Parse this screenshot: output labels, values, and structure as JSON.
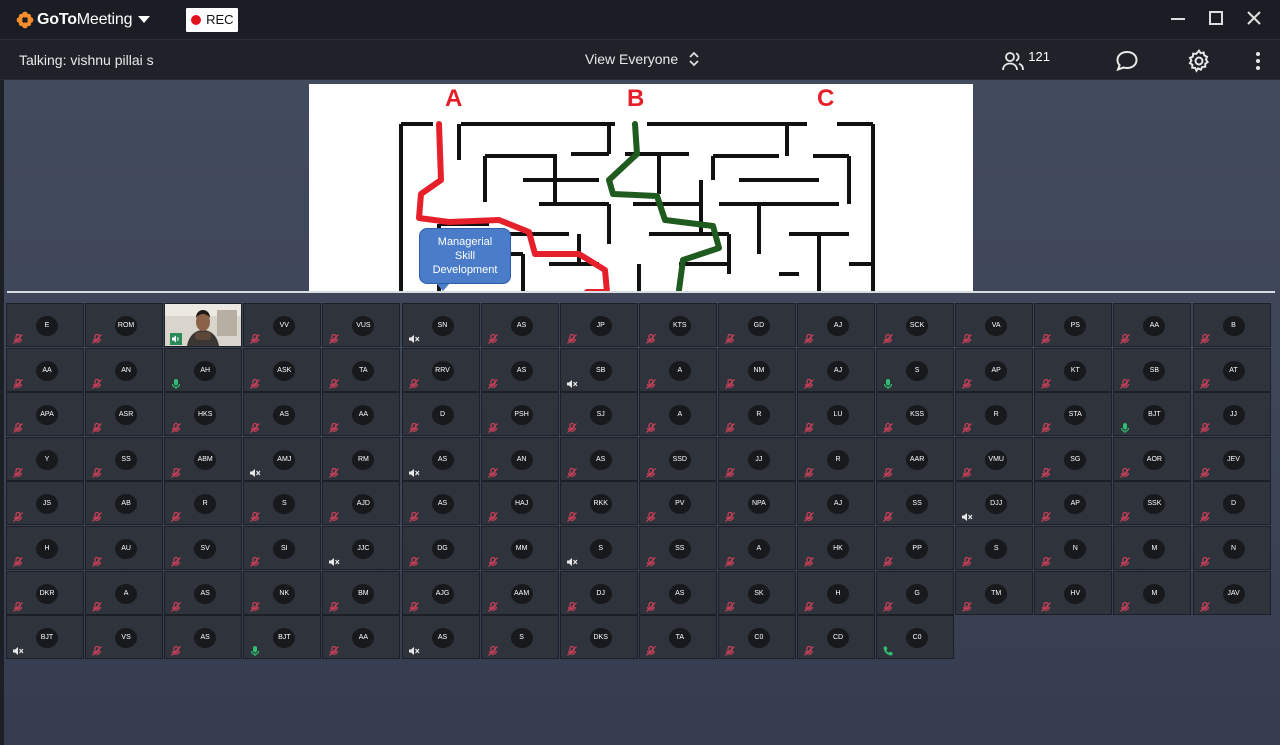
{
  "app": {
    "logo_bold": "GoTo",
    "logo_light": "Meeting",
    "rec_label": "REC"
  },
  "toolbar": {
    "talking": "Talking: vishnu pillai s",
    "view_label": "View Everyone",
    "attendee_count": "121"
  },
  "presentation": {
    "label_a": "A",
    "label_b": "B",
    "label_c": "C",
    "bubble_line1": "Managerial",
    "bubble_line2": "Skill",
    "bubble_line3": "Development"
  },
  "colors": {
    "brand_orange": "#f68d2e",
    "rec_red": "#e0141e",
    "muted_red": "#d0415a",
    "active_green": "#2fbf71",
    "maze_red": "#e5202a",
    "maze_green": "#1f5a1f"
  },
  "participants": [
    {
      "i": "E",
      "s": "m"
    },
    {
      "i": "ROM",
      "s": "m"
    },
    {
      "i": "",
      "s": "video"
    },
    {
      "i": "VV",
      "s": "m"
    },
    {
      "i": "VUS",
      "s": "m"
    },
    {
      "i": "SN",
      "s": "x"
    },
    {
      "i": "AS",
      "s": "m"
    },
    {
      "i": "JP",
      "s": "m"
    },
    {
      "i": "KTS",
      "s": "m"
    },
    {
      "i": "GD",
      "s": "m"
    },
    {
      "i": "AJ",
      "s": "m"
    },
    {
      "i": "SCK",
      "s": "m"
    },
    {
      "i": "VA",
      "s": "m"
    },
    {
      "i": "PS",
      "s": "m"
    },
    {
      "i": "AA",
      "s": "m"
    },
    {
      "i": "B",
      "s": "m"
    },
    {
      "i": "AA",
      "s": "m"
    },
    {
      "i": "AN",
      "s": "m"
    },
    {
      "i": "AH",
      "s": "g"
    },
    {
      "i": "ASK",
      "s": "m"
    },
    {
      "i": "TA",
      "s": "m"
    },
    {
      "i": "RRV",
      "s": "m"
    },
    {
      "i": "AS",
      "s": "m"
    },
    {
      "i": "SB",
      "s": "x"
    },
    {
      "i": "A",
      "s": "m"
    },
    {
      "i": "NM",
      "s": "m"
    },
    {
      "i": "AJ",
      "s": "m"
    },
    {
      "i": "S",
      "s": "g"
    },
    {
      "i": "AP",
      "s": "m"
    },
    {
      "i": "KT",
      "s": "m"
    },
    {
      "i": "SB",
      "s": "m"
    },
    {
      "i": "AT",
      "s": "m"
    },
    {
      "i": "APA",
      "s": "m"
    },
    {
      "i": "ASR",
      "s": "m"
    },
    {
      "i": "HKS",
      "s": "m"
    },
    {
      "i": "AS",
      "s": "m"
    },
    {
      "i": "AA",
      "s": "m"
    },
    {
      "i": "D",
      "s": "m"
    },
    {
      "i": "PSH",
      "s": "m"
    },
    {
      "i": "SJ",
      "s": "m"
    },
    {
      "i": "A",
      "s": "m"
    },
    {
      "i": "R",
      "s": "m"
    },
    {
      "i": "LU",
      "s": "m"
    },
    {
      "i": "KSS",
      "s": "m"
    },
    {
      "i": "R",
      "s": "m"
    },
    {
      "i": "STA",
      "s": "m"
    },
    {
      "i": "BJT",
      "s": "g"
    },
    {
      "i": "JJ",
      "s": "m"
    },
    {
      "i": "Y",
      "s": "m"
    },
    {
      "i": "SS",
      "s": "m"
    },
    {
      "i": "ABM",
      "s": "m"
    },
    {
      "i": "AMJ",
      "s": "x"
    },
    {
      "i": "RM",
      "s": "m"
    },
    {
      "i": "AS",
      "s": "x"
    },
    {
      "i": "AN",
      "s": "m"
    },
    {
      "i": "AS",
      "s": "m"
    },
    {
      "i": "SSD",
      "s": "m"
    },
    {
      "i": "JJ",
      "s": "m"
    },
    {
      "i": "R",
      "s": "m"
    },
    {
      "i": "AAR",
      "s": "m"
    },
    {
      "i": "VMU",
      "s": "m"
    },
    {
      "i": "SG",
      "s": "m"
    },
    {
      "i": "AOR",
      "s": "m"
    },
    {
      "i": "JEV",
      "s": "m"
    },
    {
      "i": "JS",
      "s": "m"
    },
    {
      "i": "AB",
      "s": "m"
    },
    {
      "i": "R",
      "s": "m"
    },
    {
      "i": "S",
      "s": "m"
    },
    {
      "i": "AJD",
      "s": "m"
    },
    {
      "i": "AS",
      "s": "m"
    },
    {
      "i": "HAJ",
      "s": "m"
    },
    {
      "i": "RKK",
      "s": "m"
    },
    {
      "i": "PV",
      "s": "m"
    },
    {
      "i": "NPA",
      "s": "m"
    },
    {
      "i": "AJ",
      "s": "m"
    },
    {
      "i": "SS",
      "s": "m"
    },
    {
      "i": "DJJ",
      "s": "x"
    },
    {
      "i": "AP",
      "s": "m"
    },
    {
      "i": "SSK",
      "s": "m"
    },
    {
      "i": "D",
      "s": "m"
    },
    {
      "i": "H",
      "s": "m"
    },
    {
      "i": "AU",
      "s": "m"
    },
    {
      "i": "SV",
      "s": "m"
    },
    {
      "i": "SI",
      "s": "m"
    },
    {
      "i": "JJC",
      "s": "x"
    },
    {
      "i": "DG",
      "s": "m"
    },
    {
      "i": "MM",
      "s": "m"
    },
    {
      "i": "S",
      "s": "x"
    },
    {
      "i": "SS",
      "s": "m"
    },
    {
      "i": "A",
      "s": "m"
    },
    {
      "i": "HK",
      "s": "m"
    },
    {
      "i": "PP",
      "s": "m"
    },
    {
      "i": "S",
      "s": "m"
    },
    {
      "i": "N",
      "s": "m"
    },
    {
      "i": "M",
      "s": "m"
    },
    {
      "i": "N",
      "s": "m"
    },
    {
      "i": "DKR",
      "s": "m"
    },
    {
      "i": "A",
      "s": "m"
    },
    {
      "i": "AS",
      "s": "m"
    },
    {
      "i": "NK",
      "s": "m"
    },
    {
      "i": "BM",
      "s": "m"
    },
    {
      "i": "AJG",
      "s": "m"
    },
    {
      "i": "AAM",
      "s": "m"
    },
    {
      "i": "DJ",
      "s": "m"
    },
    {
      "i": "AS",
      "s": "m"
    },
    {
      "i": "SK",
      "s": "m"
    },
    {
      "i": "H",
      "s": "m"
    },
    {
      "i": "G",
      "s": "m"
    },
    {
      "i": "TM",
      "s": "m"
    },
    {
      "i": "HV",
      "s": "m"
    },
    {
      "i": "M",
      "s": "m"
    },
    {
      "i": "JAV",
      "s": "m"
    },
    {
      "i": "BJT",
      "s": "x"
    },
    {
      "i": "VS",
      "s": "m"
    },
    {
      "i": "AS",
      "s": "m"
    },
    {
      "i": "BJT",
      "s": "g"
    },
    {
      "i": "AA",
      "s": "m"
    },
    {
      "i": "AS",
      "s": "x"
    },
    {
      "i": "S",
      "s": "m"
    },
    {
      "i": "DKS",
      "s": "m"
    },
    {
      "i": "TA",
      "s": "m"
    },
    {
      "i": "C0",
      "s": "m"
    },
    {
      "i": "CD",
      "s": "m"
    },
    {
      "i": "C0",
      "s": "p"
    }
  ]
}
